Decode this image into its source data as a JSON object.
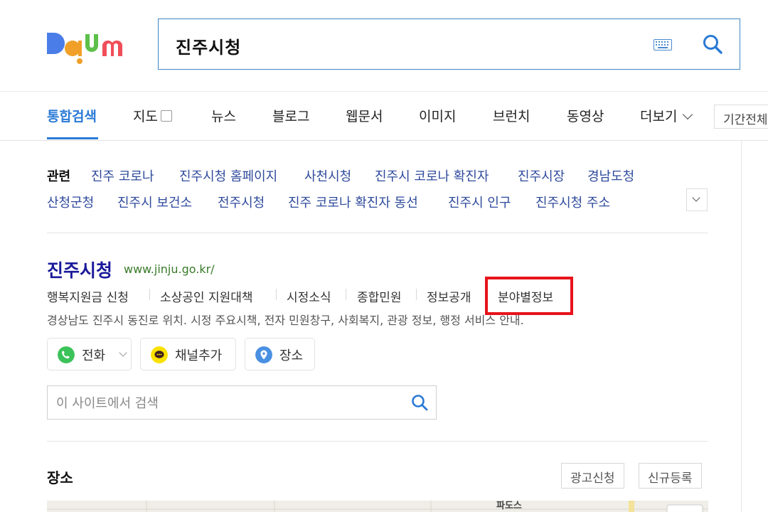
{
  "search": {
    "query": "진주시청"
  },
  "tabs": [
    {
      "label": "통합검색"
    },
    {
      "label": "지도"
    },
    {
      "label": "뉴스"
    },
    {
      "label": "블로그"
    },
    {
      "label": "웹문서"
    },
    {
      "label": "이미지"
    },
    {
      "label": "브런치"
    },
    {
      "label": "동영상"
    },
    {
      "label": "더보기"
    }
  ],
  "period_filter": "기간전체",
  "related": {
    "label": "관련",
    "items": [
      "진주 코로나",
      "진주시청 홈페이지",
      "사천시청",
      "진주시 코로나 확진자",
      "진주시장",
      "경남도청",
      "산청군청",
      "진주시 보건소",
      "전주시청",
      "진주 코로나 확진자 동선",
      "진주시 인구",
      "진주시청 주소"
    ]
  },
  "result": {
    "title": "진주시청",
    "url": "www.jinju.go.kr/",
    "sublinks": [
      "행복지원금 신청",
      "소상공인 지원대책",
      "시정소식",
      "종합민원",
      "정보공개",
      "분야별정보"
    ],
    "description": "경상남도 진주시 동진로 위치. 시정 주요시책, 전자 민원창구, 사회복지, 관광 정보, 행정 서비스 안내.",
    "actions": [
      {
        "label": "전화",
        "icon": "phone-icon",
        "color": "#3cc25a"
      },
      {
        "label": "채널추가",
        "icon": "kakao-channel-icon",
        "color": "#fae100"
      },
      {
        "label": "장소",
        "icon": "location-pin-icon",
        "color": "#4a90e2"
      }
    ],
    "site_search_placeholder": "이 사이트에서 검색"
  },
  "places": {
    "title": "장소",
    "ad_button": "광고신청",
    "register_button": "신규등록",
    "map_label": "파도스"
  },
  "colors": {
    "accent": "#2b7ad6",
    "link": "#1a1a9a",
    "highlight": "#e8131b"
  }
}
